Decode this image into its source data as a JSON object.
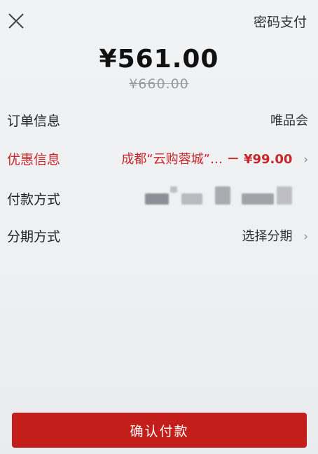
{
  "header": {
    "close_icon": "close-icon",
    "alt_pay_label": "密码支付"
  },
  "payment": {
    "amount": "¥561.00",
    "original_amount": "¥660.00"
  },
  "rows": {
    "order": {
      "label": "订单信息",
      "value": "唯品会"
    },
    "discount": {
      "label": "优惠信息",
      "text": "成都“云购蓉城”…",
      "amount": "－ ¥99.00",
      "chevron": "›"
    },
    "payment_method": {
      "label": "付款方式"
    },
    "installment": {
      "label": "分期方式",
      "value": "选择分期",
      "chevron": "›"
    }
  },
  "confirm_button": {
    "label": "确认付款"
  },
  "colors": {
    "accent_red": "#c41e1b",
    "discount_red": "#c8262a"
  }
}
